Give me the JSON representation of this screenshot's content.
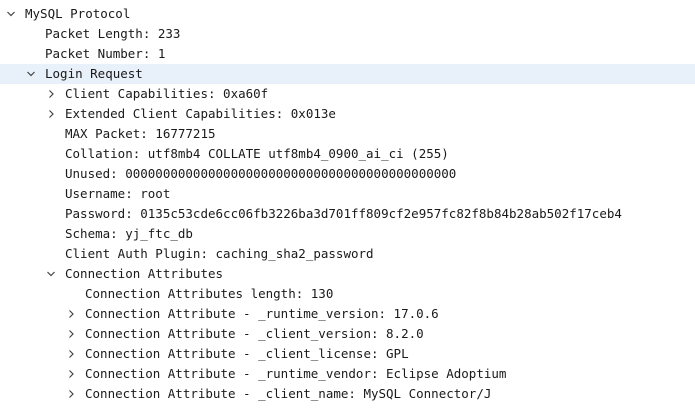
{
  "tree": {
    "clipped_top_text": ", , ,  ,  , ,   ,  ,  ,  ,  , ,  ,  ,  ,  , ",
    "mysql_protocol": "MySQL Protocol",
    "packet_length": "Packet Length: 233",
    "packet_number": "Packet Number: 1",
    "login_request": "Login Request",
    "client_capabilities": "Client Capabilities: 0xa60f",
    "ext_client_capabilities": "Extended Client Capabilities: 0x013e",
    "max_packet": "MAX Packet: 16777215",
    "collation": "Collation: utf8mb4 COLLATE utf8mb4_0900_ai_ci (255)",
    "unused": "Unused: 00000000000000000000000000000000000000000000",
    "username": "Username: root",
    "password": "Password: 0135c53cde6cc06fb3226ba3d701ff809cf2e957fc82f8b84b28ab502f17ceb4",
    "schema": "Schema: yj_ftc_db",
    "client_auth_plugin": "Client Auth Plugin: caching_sha2_password",
    "connection_attributes": "Connection Attributes",
    "conn_attr_length": "Connection Attributes length: 130",
    "attr_runtime_version": "Connection Attribute - _runtime_version: 17.0.6",
    "attr_client_version": "Connection Attribute - _client_version: 8.2.0",
    "attr_client_license": "Connection Attribute - _client_license: GPL",
    "attr_runtime_vendor": "Connection Attribute - _runtime_vendor: Eclipse Adoptium",
    "attr_client_name": "Connection Attribute - _client_name: MySQL Connector/J"
  },
  "icons": {
    "expanded": "chevron-down-icon",
    "collapsed": "chevron-right-icon"
  },
  "colors": {
    "selection_bg": "#e8f0f9",
    "text": "#1a1a1a",
    "arrow": "#444444"
  }
}
